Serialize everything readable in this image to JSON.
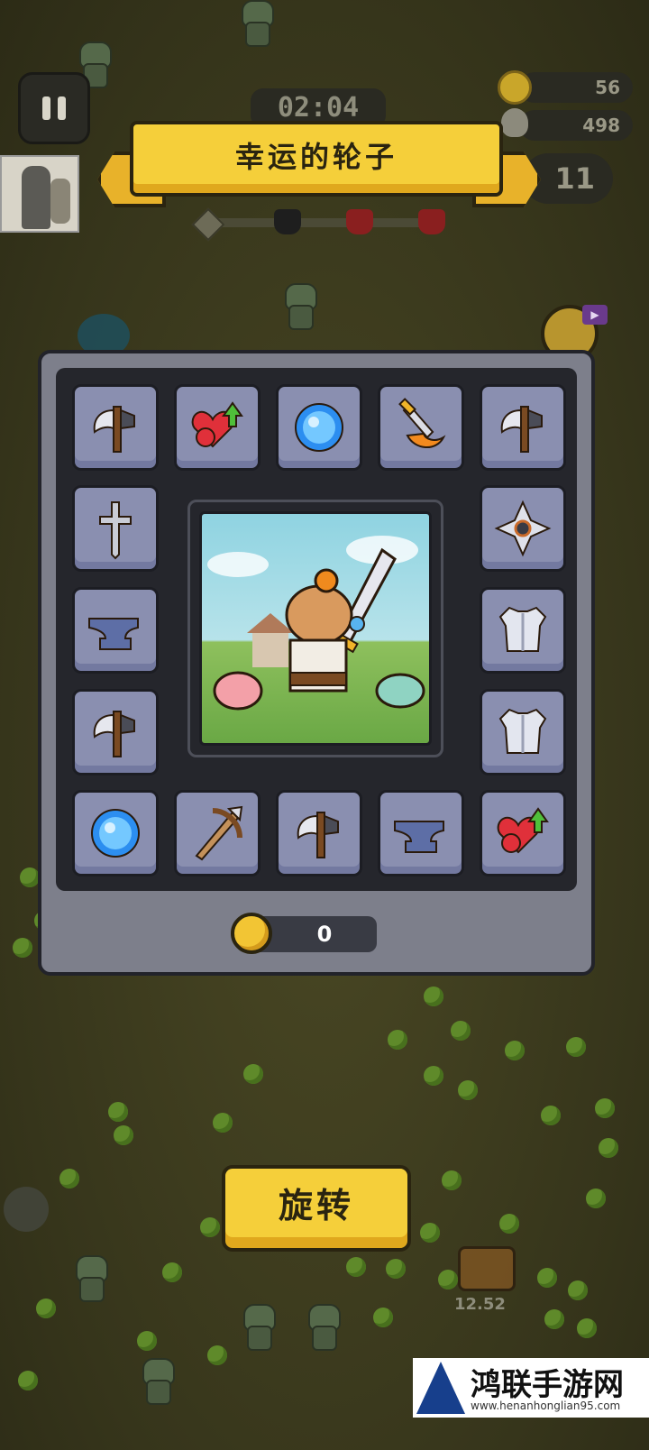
{
  "hud": {
    "pause_icon": "pause-icon",
    "timer": "02:04",
    "coins": "56",
    "kills": "498",
    "level": "11"
  },
  "banner": {
    "title": "幸运的轮子"
  },
  "wheel": {
    "slots": [
      {
        "icon": "axe-icon"
      },
      {
        "icon": "heart-upgrade-icon"
      },
      {
        "icon": "energy-orb-icon"
      },
      {
        "icon": "flaming-dagger-icon"
      },
      {
        "icon": "axe-icon"
      },
      {
        "icon": "holy-cross-icon"
      },
      {
        "icon": "shuriken-icon"
      },
      {
        "icon": "anvil-icon"
      },
      {
        "icon": "armor-icon"
      },
      {
        "icon": "axe-icon"
      },
      {
        "icon": "armor-icon"
      },
      {
        "icon": "energy-orb-icon"
      },
      {
        "icon": "crossbow-icon"
      },
      {
        "icon": "axe-icon"
      },
      {
        "icon": "anvil-icon"
      },
      {
        "icon": "heart-upgrade-icon"
      }
    ],
    "coin_cost": "0"
  },
  "spin_button": {
    "label": "旋转"
  },
  "chest": {
    "timer": "12.52"
  },
  "watermark": {
    "title": "鸿联手游网",
    "url": "www.henanhonglian95.com"
  }
}
